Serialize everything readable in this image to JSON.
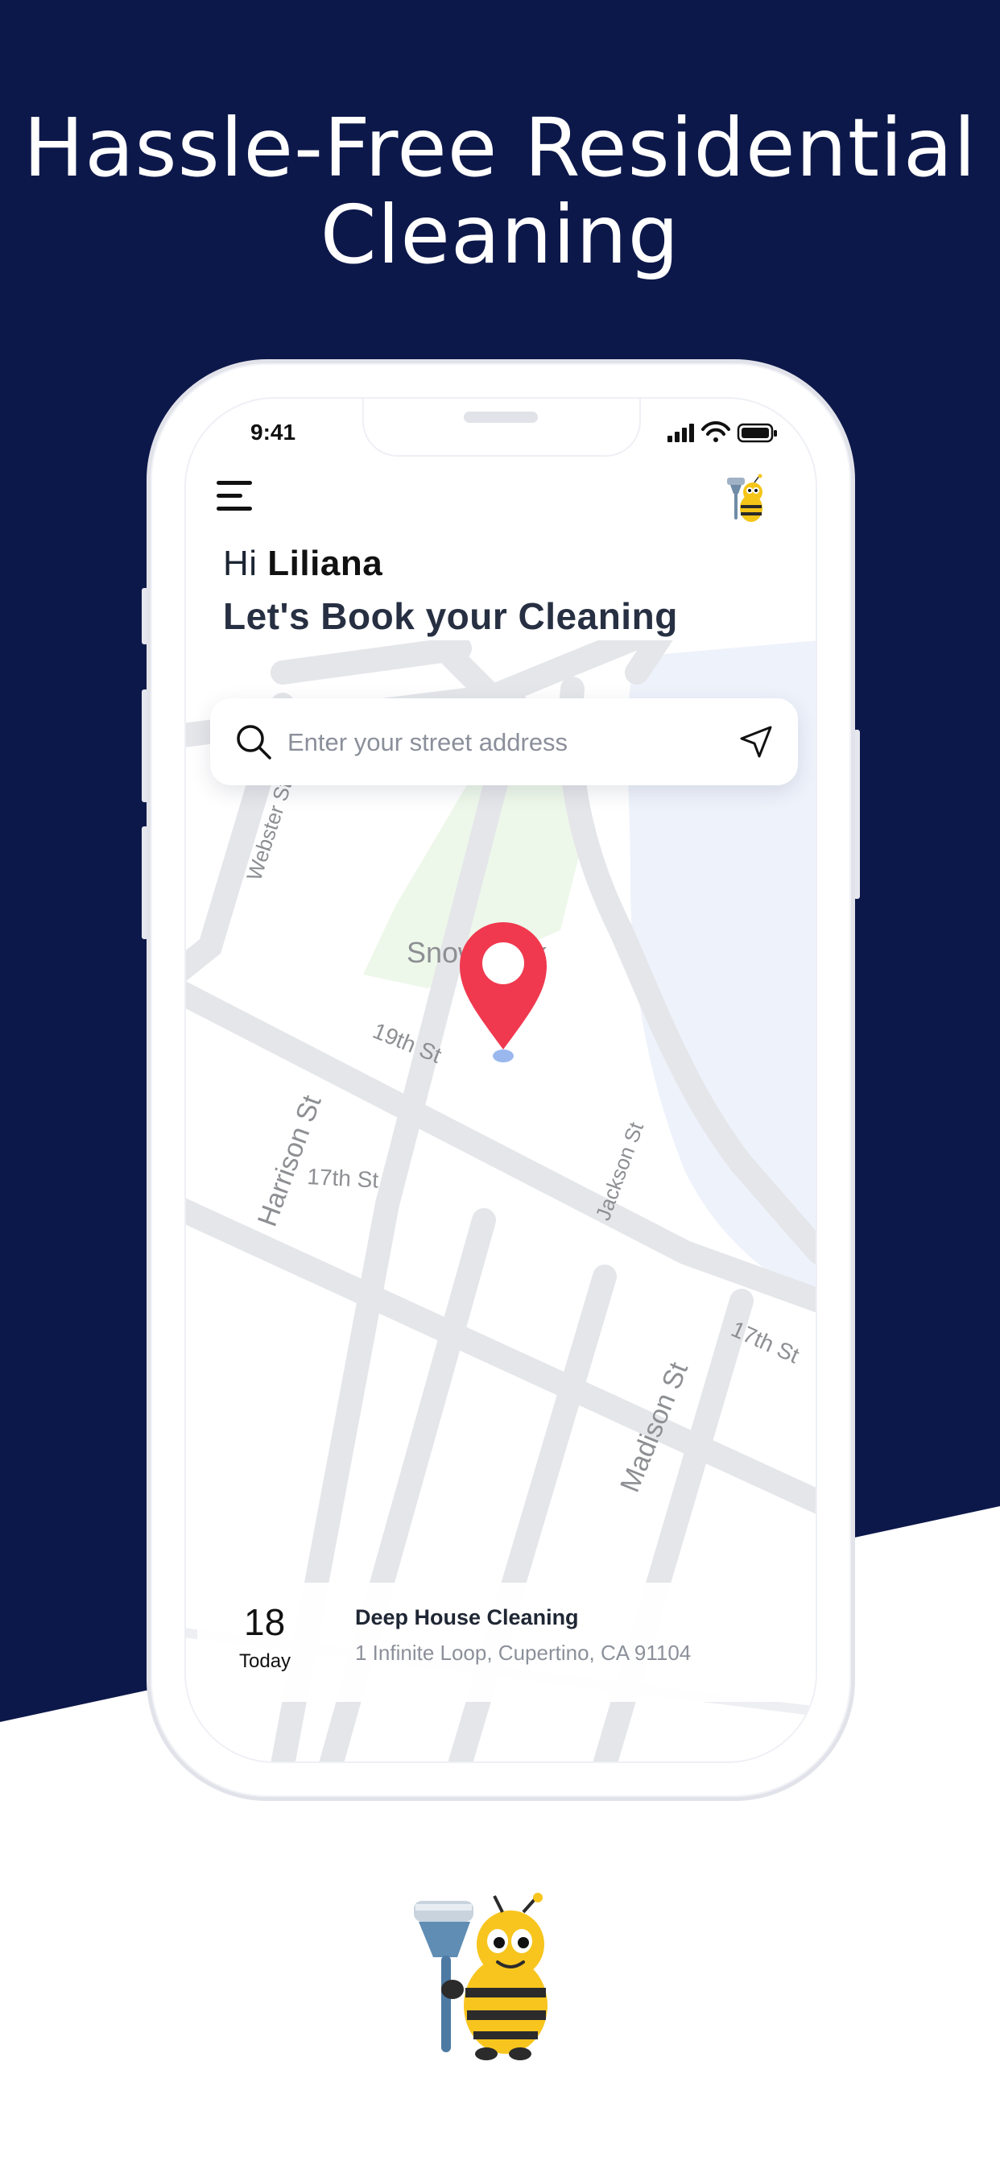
{
  "hero": {
    "title_line1": "Hassle-Free Residential",
    "title_line2": "Cleaning"
  },
  "colors": {
    "navy": "#0d184a",
    "pin_red": "#f0394f",
    "map_road": "#e5e6ea",
    "map_water": "#eef2fb",
    "map_park": "#eef8ea"
  },
  "status_bar": {
    "time": "9:41",
    "icons": [
      "signal-icon",
      "wifi-icon",
      "battery-icon"
    ]
  },
  "header": {
    "menu_icon": "menu-icon",
    "avatar_icon": "bee-mascot-icon"
  },
  "greeting": {
    "hi": "Hi",
    "name": "Liliana",
    "subtitle": "Let's Book your Cleaning"
  },
  "search": {
    "placeholder": "Enter your street address",
    "value": ""
  },
  "map": {
    "labels": {
      "park": "Snow Park",
      "webster": "Webster St",
      "harrison": "Harrison St",
      "nineteenth": "19th St",
      "seventeenth_left": "17th St",
      "jackson": "Jackson St",
      "seventeenth_right": "17th St",
      "madison": "Madison St"
    },
    "pin_icon": "location-pin-icon"
  },
  "booking": {
    "day": "18",
    "day_label": "Today",
    "title": "Deep House Cleaning",
    "address": "1 Infinite Loop, Cupertino, CA 91104"
  }
}
